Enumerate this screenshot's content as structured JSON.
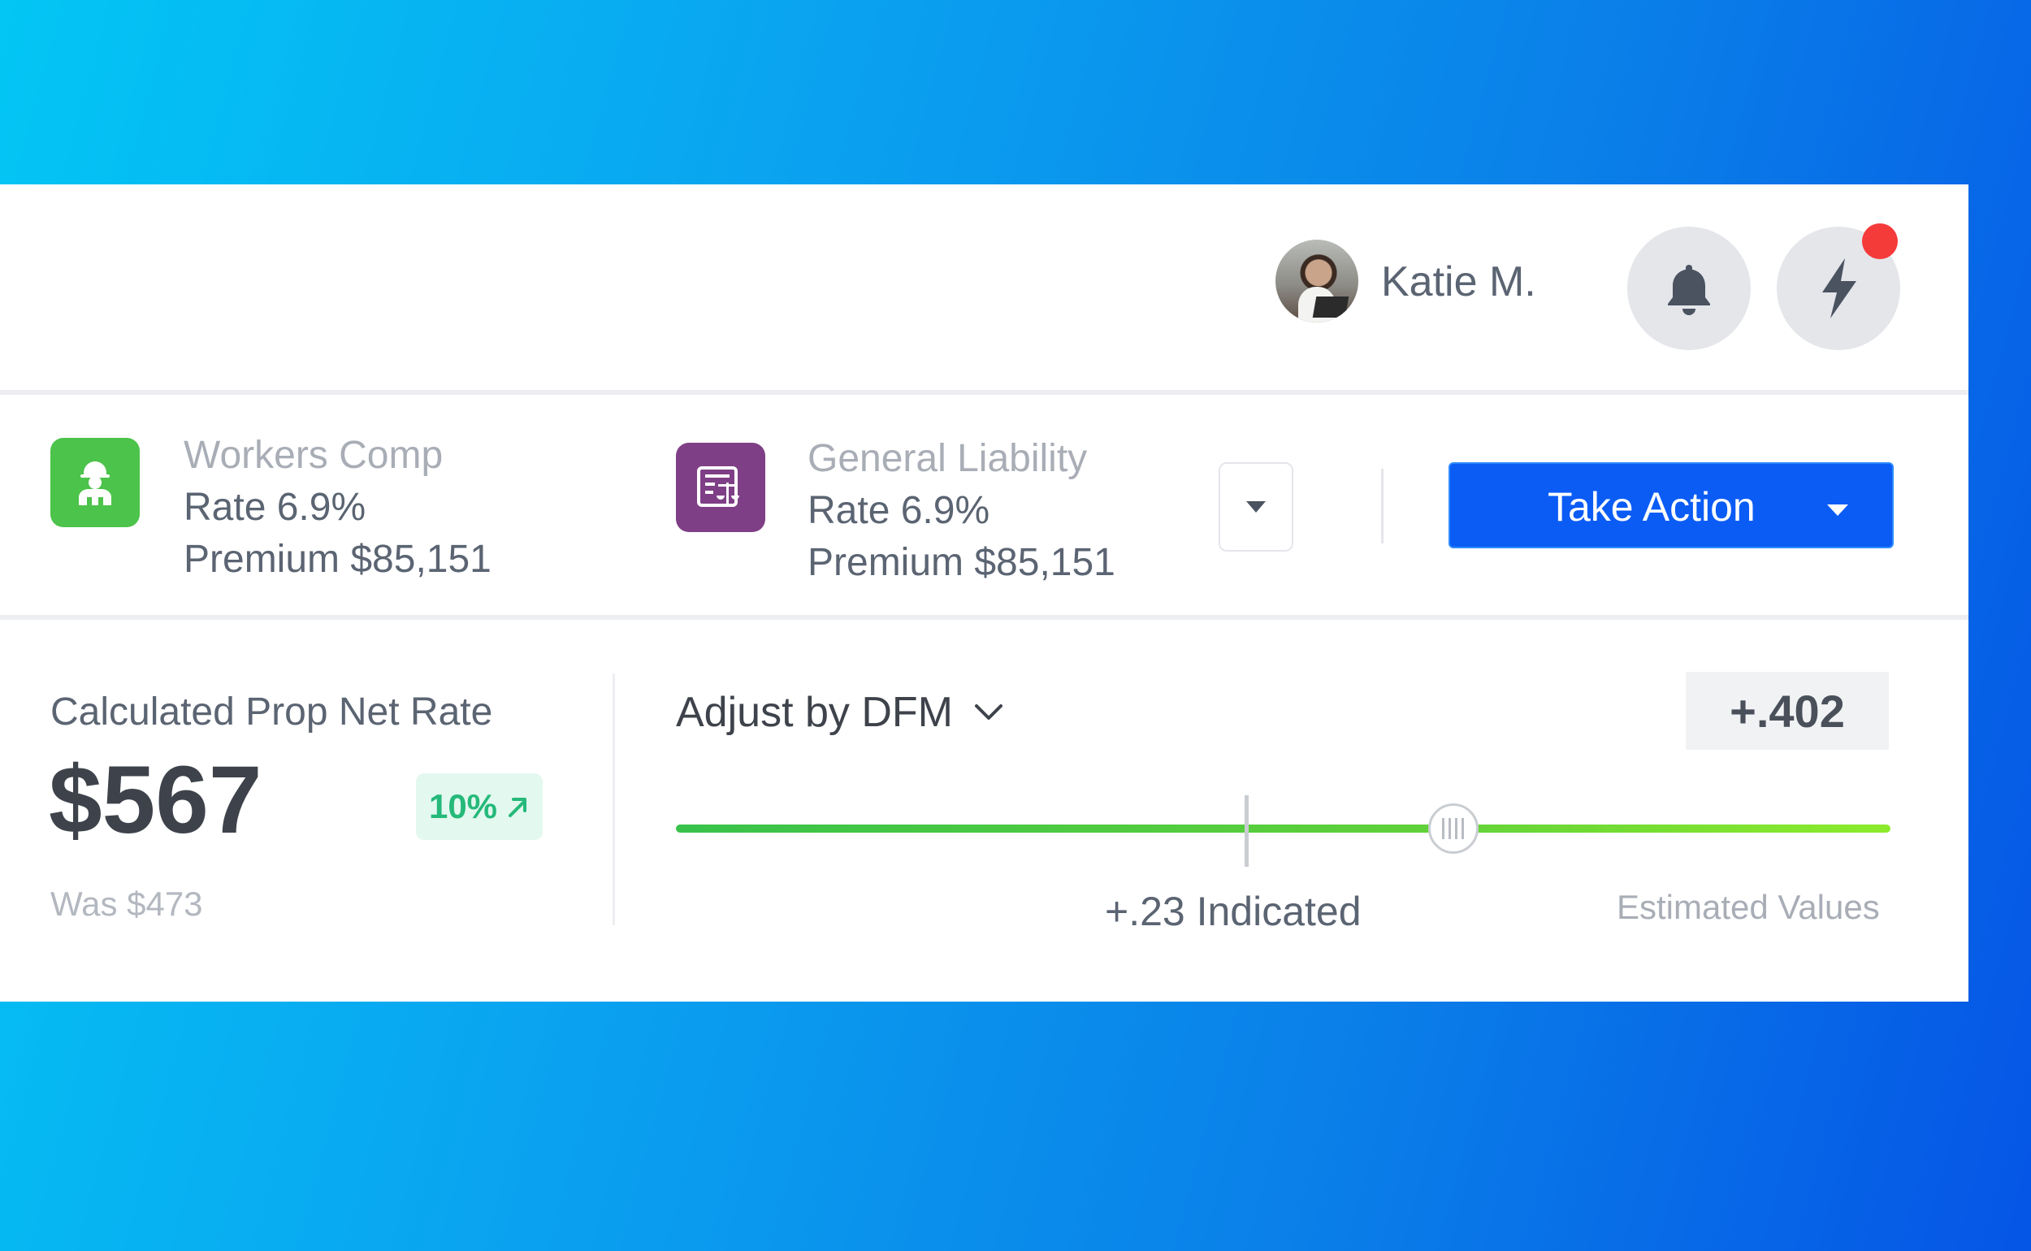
{
  "header": {
    "user_name": "Katie M.",
    "avatar_icon": "user-avatar",
    "notifications_icon": "bell-icon",
    "actions_icon": "lightning-icon",
    "alert_color": "#f53a3a"
  },
  "products": [
    {
      "name": "Workers Comp",
      "rate": "Rate 6.9%",
      "premium": "Premium $85,151",
      "icon": "worker-icon",
      "color": "#4cc34a"
    },
    {
      "name": "General Liability",
      "rate": "Rate 6.9%",
      "premium": "Premium $85,151",
      "icon": "liability-document-icon",
      "color": "#7e3f86"
    }
  ],
  "take_action": {
    "label": "Take Action",
    "color": "#0b5cf5"
  },
  "metric": {
    "title": "Calculated Prop Net Rate",
    "value": "$567",
    "change": "10%",
    "change_icon": "arrow-up-right-icon",
    "previous": "Was $473"
  },
  "adjust": {
    "label": "Adjust by DFM",
    "value": "+.402",
    "indicated_label": "+.23 Indicated",
    "estimated_label": "Estimated Values",
    "slider_level": 0.64,
    "indicated_level": 0.47
  }
}
